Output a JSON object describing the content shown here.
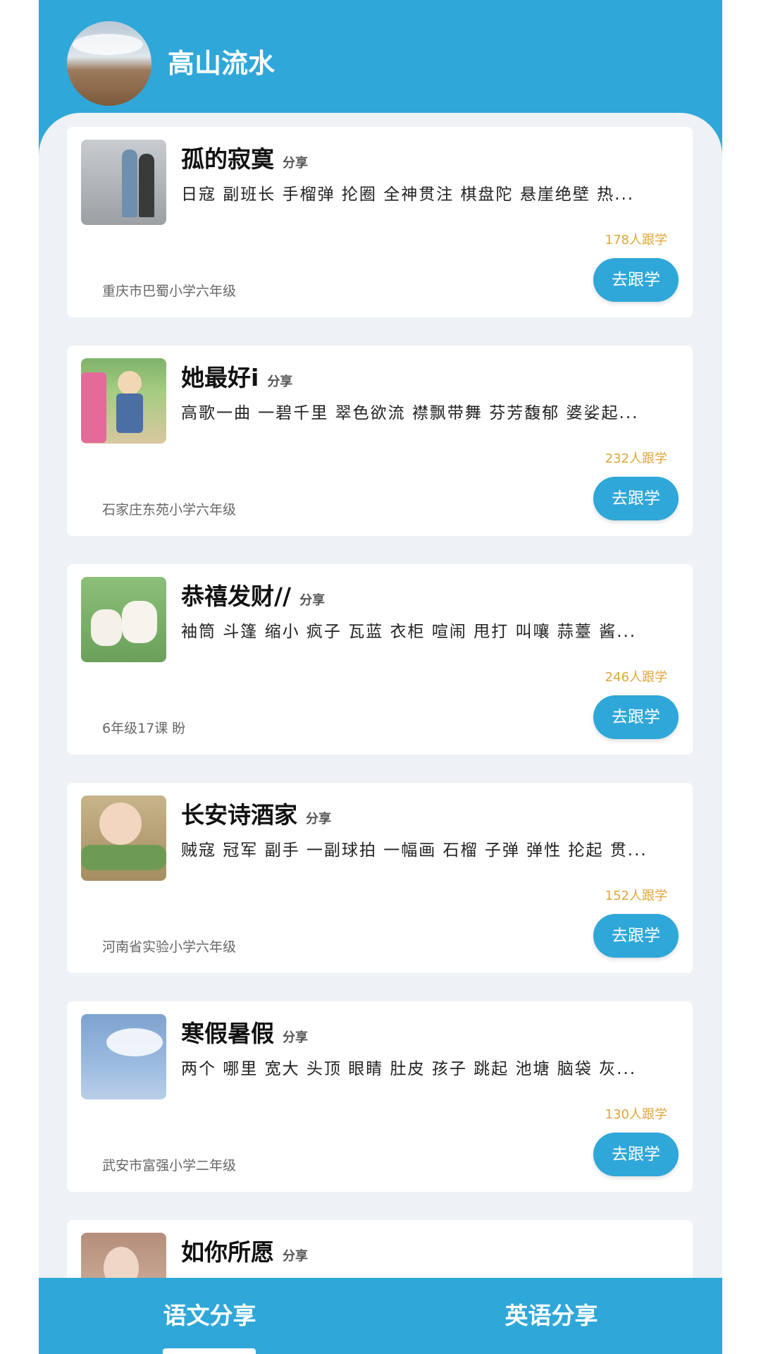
{
  "header": {
    "username": "高山流水"
  },
  "cards": [
    {
      "title": "孤的寂寞",
      "share_label": "分享",
      "words": "日寇 副班长 手榴弹 抡圈 全神贯注 棋盘陀 悬崖绝壁 热...",
      "count": "178人跟学",
      "school": "重庆市巴蜀小学六年级",
      "button": "去跟学"
    },
    {
      "title": "她最好i",
      "share_label": "分享",
      "words": "高歌一曲 一碧千里 翠色欲流 襟飘带舞 芬芳馥郁 婆娑起...",
      "count": "232人跟学",
      "school": "石家庄东苑小学六年级",
      "button": "去跟学"
    },
    {
      "title": "恭禧发财//",
      "share_label": "分享",
      "words": "袖筒 斗篷 缩小 疯子 瓦蓝 衣柜 喧闹 甩打 叫嚷 蒜薹 酱...",
      "count": "246人跟学",
      "school": "6年级17课 盼",
      "button": "去跟学"
    },
    {
      "title": "长安诗酒家",
      "share_label": "分享",
      "words": "贼寇 冠军 副手 一副球拍 一幅画 石榴 子弹 弹性 抡起 贯...",
      "count": "152人跟学",
      "school": "河南省实验小学六年级",
      "button": "去跟学"
    },
    {
      "title": "寒假暑假",
      "share_label": "分享",
      "words": "两个 哪里 宽大 头顶 眼睛 肚皮 孩子 跳起 池塘 脑袋 灰...",
      "count": "130人跟学",
      "school": "武安市富强小学二年级",
      "button": "去跟学"
    },
    {
      "title": "如你所愿",
      "share_label": "分享"
    }
  ],
  "bottom_nav": {
    "tabs": [
      {
        "label": "语文分享",
        "active": true
      },
      {
        "label": "英语分享",
        "active": false
      }
    ]
  },
  "colors": {
    "primary": "#2fa7d9",
    "background": "#eef1f5",
    "count": "#e0a53a"
  }
}
